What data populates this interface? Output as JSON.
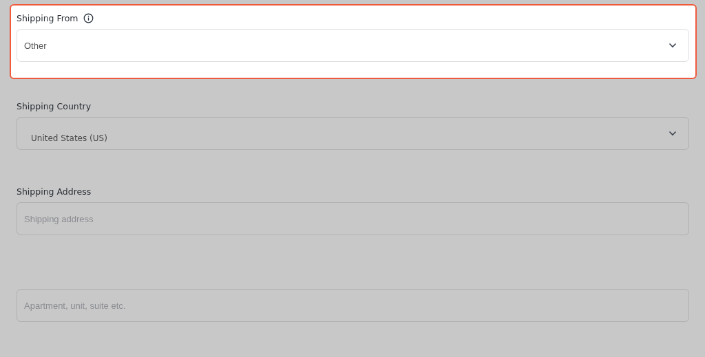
{
  "fields": [
    {
      "kind": "select",
      "label": "Shipping From",
      "info": true,
      "highlighted": true,
      "value": "Other"
    },
    {
      "kind": "select",
      "label": "Shipping Country",
      "info": false,
      "highlighted": false,
      "value": "United States (US)"
    },
    {
      "kind": "text",
      "label": "Shipping Address",
      "info": false,
      "highlighted": false,
      "placeholder": "Shipping address"
    },
    {
      "kind": "text",
      "highlighted": false,
      "placeholder": "Apartment, unit, suite etc."
    }
  ]
}
